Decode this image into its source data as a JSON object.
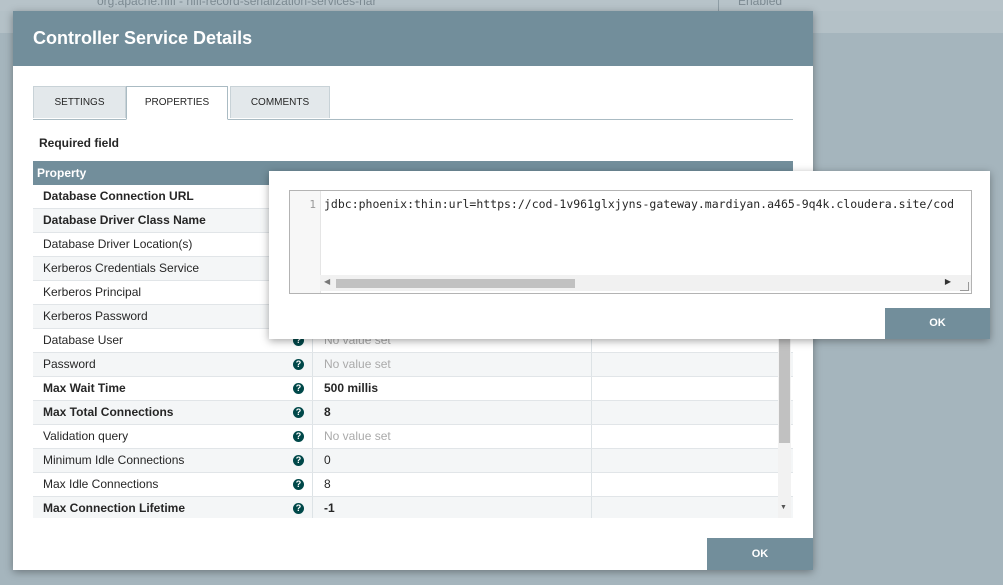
{
  "background": {
    "partial_text": "org.apache.nifi - nifi-record-serialization-services-nar",
    "status": "Enabled"
  },
  "dialog": {
    "title": "Controller Service Details",
    "tabs": [
      {
        "label": "SETTINGS"
      },
      {
        "label": "PROPERTIES"
      },
      {
        "label": "COMMENTS"
      }
    ],
    "required_field_label": "Required field",
    "table_header_property": "Property",
    "help_glyph": "?",
    "rows": [
      {
        "name": "Database Connection URL",
        "value": ""
      },
      {
        "name": "Database Driver Class Name",
        "value": ""
      },
      {
        "name": "Database Driver Location(s)",
        "value": ""
      },
      {
        "name": "Kerberos Credentials Service",
        "value": ""
      },
      {
        "name": "Kerberos Principal",
        "value": ""
      },
      {
        "name": "Kerberos Password",
        "value": ""
      },
      {
        "name": "Database User",
        "value": "No value set"
      },
      {
        "name": "Password",
        "value": "No value set"
      },
      {
        "name": "Max Wait Time",
        "value": "500 millis"
      },
      {
        "name": "Max Total Connections",
        "value": "8"
      },
      {
        "name": "Validation query",
        "value": "No value set"
      },
      {
        "name": "Minimum Idle Connections",
        "value": "0"
      },
      {
        "name": "Max Idle Connections",
        "value": "8"
      },
      {
        "name": "Max Connection Lifetime",
        "value": "-1"
      }
    ],
    "ok_label": "OK"
  },
  "editor": {
    "line_number": "1",
    "code": "jdbc:phoenix:thin:url=https://cod-1v961glxjyns-gateway.mardiyan.a465-9q4k.cloudera.site/cod",
    "ok_label": "OK"
  },
  "colors": {
    "header": "#728e9b",
    "help_icon": "#004849"
  }
}
